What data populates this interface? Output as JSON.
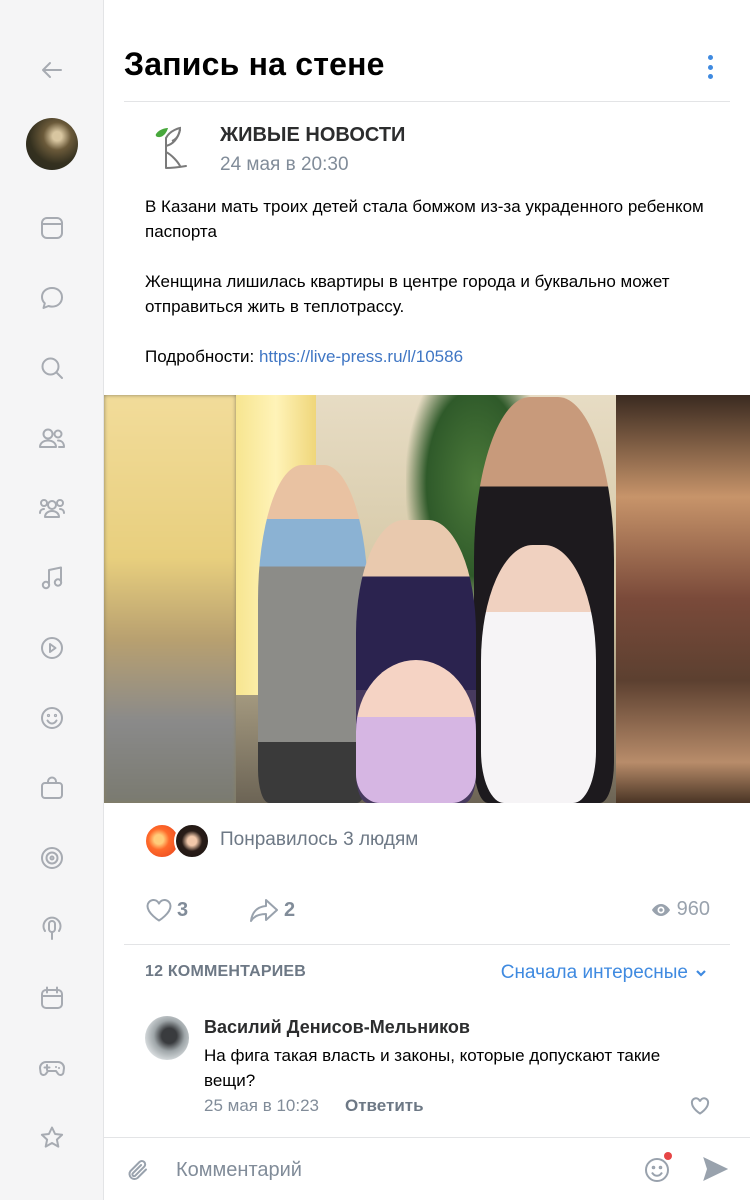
{
  "sidebar": {
    "items": [
      {
        "icon": "back-arrow-icon"
      },
      {
        "icon": "avatar"
      },
      {
        "icon": "news-icon"
      },
      {
        "icon": "messages-icon"
      },
      {
        "icon": "search-icon"
      },
      {
        "icon": "friends-icon"
      },
      {
        "icon": "communities-icon"
      },
      {
        "icon": "music-icon"
      },
      {
        "icon": "video-icon"
      },
      {
        "icon": "stickers-icon"
      },
      {
        "icon": "market-icon"
      },
      {
        "icon": "clips-icon"
      },
      {
        "icon": "podcasts-icon"
      },
      {
        "icon": "events-icon"
      },
      {
        "icon": "games-icon"
      },
      {
        "icon": "bookmarks-icon"
      }
    ]
  },
  "header": {
    "title": "Запись на стене"
  },
  "post": {
    "author": "ЖИВЫЕ НОВОСТИ",
    "date": "24 мая в 20:30",
    "paragraph1": "В Казани мать троих детей стала бомжом из-за украденного ребенком паспорта",
    "paragraph2": "Женщина лишилась квартиры в центре города и буквально может отправиться жить в теплотрассу.",
    "details_label": "Подробности: ",
    "details_link": "https://live-press.ru/l/10586"
  },
  "likes": {
    "liked_text": "Понравилось 3 людям",
    "like_count": "3",
    "share_count": "2",
    "views": "960"
  },
  "comments": {
    "count_label": "12 КОММЕНТАРИЕВ",
    "sort_label": "Сначала интересные",
    "items": [
      {
        "author": "Василий Денисов-Мельников",
        "text": "На фига такая власть и законы, которые допускают такие вещи?",
        "date": "25 мая в 10:23",
        "reply_label": "Ответить"
      }
    ]
  },
  "composer": {
    "placeholder": "Комментарий"
  },
  "colors": {
    "accent": "#3f8ae0",
    "secondary_text": "#818c99",
    "icon": "#99a2ad",
    "notification_dot": "#e64646"
  }
}
